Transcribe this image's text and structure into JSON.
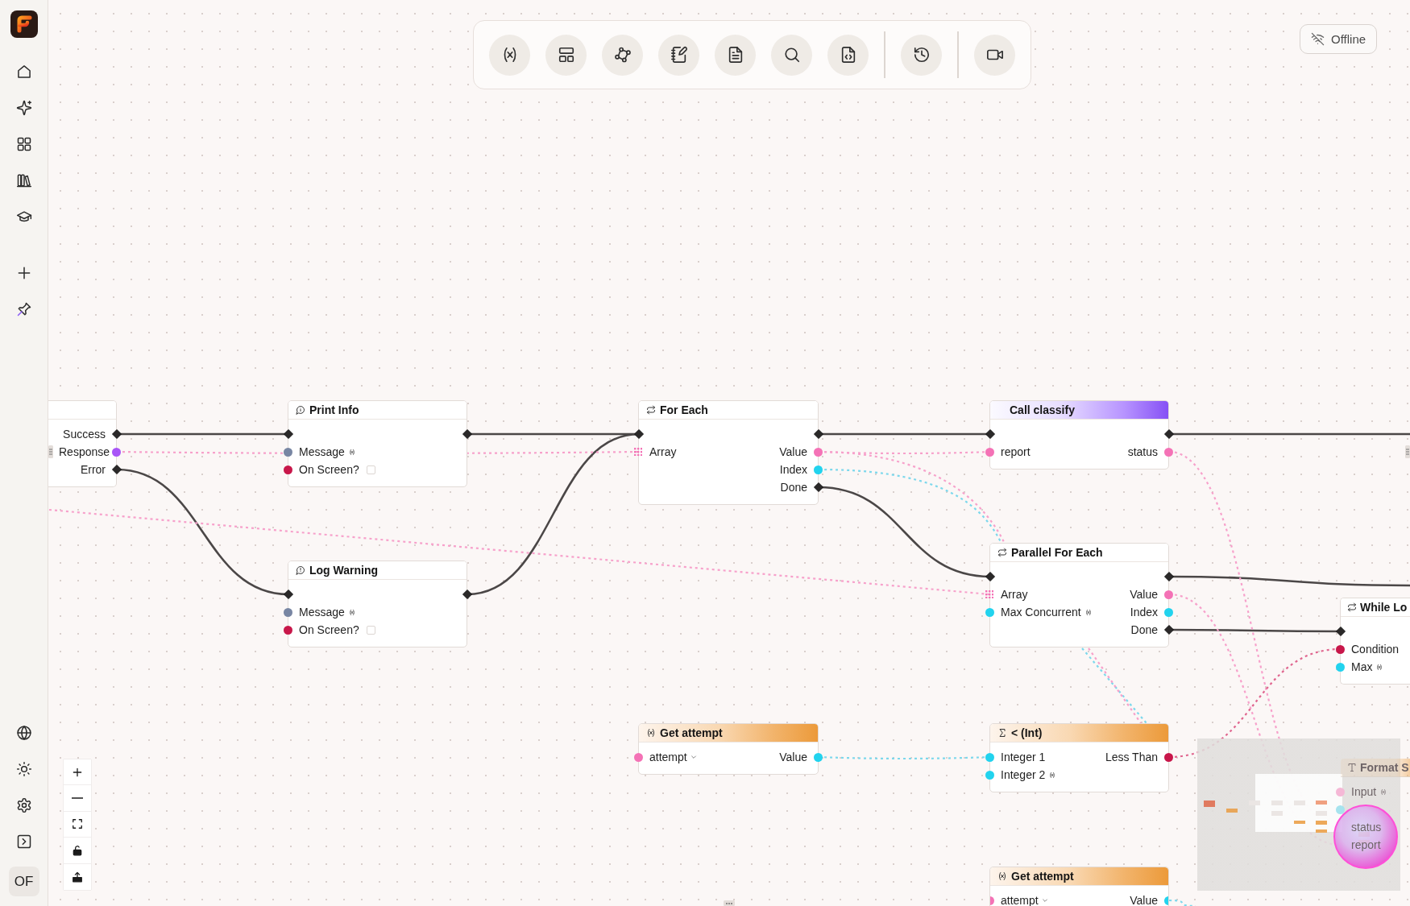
{
  "sidebar": {
    "avatar": "OF"
  },
  "connection": {
    "label": "Offline"
  },
  "nodes": [
    {
      "outputs": [
        {
          "kind": "exec",
          "label": "Success"
        },
        {
          "kind": "data",
          "label": "Response",
          "color": "#a855f7"
        },
        {
          "kind": "exec",
          "label": "Error"
        }
      ]
    },
    {
      "kind": "log",
      "title": "Print Info",
      "inputs": [
        {
          "kind": "exec"
        },
        {
          "kind": "data",
          "label": "Message",
          "color": "#7886a3",
          "variable": true
        },
        {
          "kind": "data",
          "label": "On Screen?",
          "color": "#c8174a",
          "variable": false,
          "checked": false
        }
      ],
      "outputs": [
        {
          "kind": "exec"
        }
      ]
    },
    {
      "kind": "warning",
      "title": "Log Warning",
      "inputs": [
        {
          "kind": "exec"
        },
        {
          "kind": "data",
          "label": "Message",
          "color": "#7886a3",
          "variable": true
        },
        {
          "kind": "data",
          "label": "On Screen?",
          "color": "#c8174a",
          "variable": false,
          "checked": false
        }
      ],
      "outputs": [
        {
          "kind": "exec"
        }
      ]
    },
    {
      "kind": "loop",
      "title": "For Each",
      "inputs": [
        {
          "kind": "exec"
        },
        {
          "kind": "array",
          "label": "Array",
          "color": "#f472b6"
        }
      ],
      "outputs": [
        {
          "kind": "exec"
        },
        {
          "kind": "data",
          "label": "Value",
          "color": "#f472b6"
        },
        {
          "kind": "data",
          "label": "Index",
          "color": "#22d3ee"
        },
        {
          "kind": "exec",
          "label": "Done"
        }
      ]
    },
    {
      "kind": "call",
      "title": "Call classify",
      "inputs": [
        {
          "kind": "exec"
        },
        {
          "kind": "data",
          "label": "report",
          "color": "#f472b6",
          "variable": false
        }
      ],
      "outputs": [
        {
          "kind": "exec"
        },
        {
          "kind": "data",
          "label": "status",
          "color": "#f472b6"
        }
      ]
    },
    {
      "kind": "loop",
      "title": "Parallel For Each",
      "inputs": [
        {
          "kind": "exec"
        },
        {
          "kind": "array",
          "label": "Array",
          "color": "#f472b6"
        },
        {
          "kind": "data",
          "label": "Max Concurrent",
          "color": "#22d3ee",
          "variable": true
        }
      ],
      "outputs": [
        {
          "kind": "exec"
        },
        {
          "kind": "data",
          "label": "Value",
          "color": "#f472b6"
        },
        {
          "kind": "data",
          "label": "Index",
          "color": "#22d3ee"
        },
        {
          "kind": "exec",
          "label": "Done"
        }
      ]
    },
    {
      "kind": "loop",
      "title": "While Lo",
      "inputs": [
        {
          "kind": "exec"
        },
        {
          "kind": "data",
          "label": "Condition",
          "color": "#c8174a",
          "variable": false
        },
        {
          "kind": "data",
          "label": "Max",
          "color": "#22d3ee",
          "variable": true
        }
      ]
    },
    {
      "kind": "variable",
      "title": "Get attempt",
      "inputs": [
        {
          "kind": "dropdown",
          "label": "attempt",
          "color": "#f472b6"
        }
      ],
      "outputs": [
        {
          "kind": "data",
          "label": "Value",
          "color": "#22d3ee"
        }
      ]
    },
    {
      "kind": "math",
      "title": "< (Int)",
      "inputs": [
        {
          "kind": "data",
          "label": "Integer 1",
          "color": "#22d3ee",
          "variable": false
        },
        {
          "kind": "data",
          "label": "Integer 2",
          "color": "#22d3ee",
          "variable": true
        }
      ],
      "outputs": [
        {
          "kind": "data",
          "label": "Less Than",
          "color": "#c8174a"
        }
      ]
    },
    {
      "kind": "text",
      "title": "Format S",
      "inputs": [
        {
          "kind": "data",
          "label": "Input",
          "color": "#f5b8d6",
          "variable": true
        },
        {
          "kind": "data",
          "color": "#a6e3ee",
          "variable": false
        },
        {
          "kind": "data",
          "label": "status",
          "variable": false
        },
        {
          "kind": "data",
          "label": "report",
          "variable": false
        }
      ]
    },
    {
      "kind": "variable",
      "title": "Get attempt",
      "inputs": [
        {
          "kind": "dropdown",
          "label": "attempt",
          "color": "#f472b6"
        }
      ],
      "outputs": [
        {
          "kind": "data",
          "label": "Value",
          "color": "#22d3ee"
        }
      ]
    }
  ],
  "edges": [
    {
      "kind": "exec"
    },
    {
      "kind": "exec"
    },
    {
      "kind": "exec"
    },
    {
      "kind": "exec"
    },
    {
      "kind": "exec"
    },
    {
      "kind": "exec"
    },
    {
      "kind": "exec"
    },
    {
      "kind": "exec"
    },
    {
      "kind": "exec"
    },
    {
      "kind": "data",
      "color": "#f7a1cb"
    },
    {
      "kind": "data",
      "color": "#f7a1cb"
    },
    {
      "kind": "data",
      "color": "#f7a1cb"
    },
    {
      "kind": "data",
      "color": "#f7a1cb"
    },
    {
      "kind": "data",
      "color": "#7dd8ec"
    },
    {
      "kind": "data",
      "color": "#f7a1cb"
    },
    {
      "kind": "data",
      "color": "#f7a1cb"
    },
    {
      "kind": "data",
      "color": "#e0668f"
    },
    {
      "kind": "data",
      "color": "#7dd8ec"
    },
    {
      "kind": "data",
      "color": "#7dd8ec"
    },
    {
      "kind": "data",
      "color": "#f7a1cb"
    },
    {
      "kind": "data",
      "color": "#7dd8ec"
    }
  ]
}
